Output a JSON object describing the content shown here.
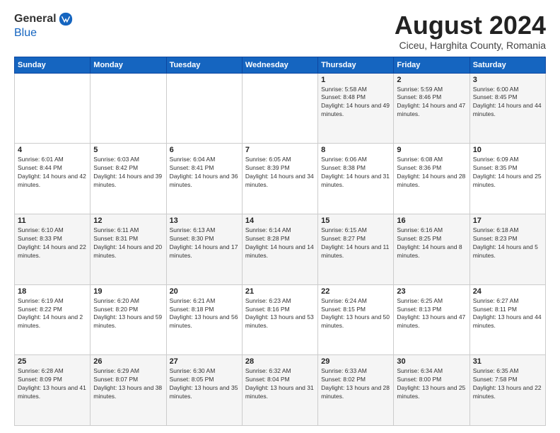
{
  "logo": {
    "general": "General",
    "blue": "Blue"
  },
  "title": {
    "month_year": "August 2024",
    "location": "Ciceu, Harghita County, Romania"
  },
  "weekdays": [
    "Sunday",
    "Monday",
    "Tuesday",
    "Wednesday",
    "Thursday",
    "Friday",
    "Saturday"
  ],
  "weeks": [
    [
      {
        "day": "",
        "info": ""
      },
      {
        "day": "",
        "info": ""
      },
      {
        "day": "",
        "info": ""
      },
      {
        "day": "",
        "info": ""
      },
      {
        "day": "1",
        "info": "Sunrise: 5:58 AM\nSunset: 8:48 PM\nDaylight: 14 hours and 49 minutes."
      },
      {
        "day": "2",
        "info": "Sunrise: 5:59 AM\nSunset: 8:46 PM\nDaylight: 14 hours and 47 minutes."
      },
      {
        "day": "3",
        "info": "Sunrise: 6:00 AM\nSunset: 8:45 PM\nDaylight: 14 hours and 44 minutes."
      }
    ],
    [
      {
        "day": "4",
        "info": "Sunrise: 6:01 AM\nSunset: 8:44 PM\nDaylight: 14 hours and 42 minutes."
      },
      {
        "day": "5",
        "info": "Sunrise: 6:03 AM\nSunset: 8:42 PM\nDaylight: 14 hours and 39 minutes."
      },
      {
        "day": "6",
        "info": "Sunrise: 6:04 AM\nSunset: 8:41 PM\nDaylight: 14 hours and 36 minutes."
      },
      {
        "day": "7",
        "info": "Sunrise: 6:05 AM\nSunset: 8:39 PM\nDaylight: 14 hours and 34 minutes."
      },
      {
        "day": "8",
        "info": "Sunrise: 6:06 AM\nSunset: 8:38 PM\nDaylight: 14 hours and 31 minutes."
      },
      {
        "day": "9",
        "info": "Sunrise: 6:08 AM\nSunset: 8:36 PM\nDaylight: 14 hours and 28 minutes."
      },
      {
        "day": "10",
        "info": "Sunrise: 6:09 AM\nSunset: 8:35 PM\nDaylight: 14 hours and 25 minutes."
      }
    ],
    [
      {
        "day": "11",
        "info": "Sunrise: 6:10 AM\nSunset: 8:33 PM\nDaylight: 14 hours and 22 minutes."
      },
      {
        "day": "12",
        "info": "Sunrise: 6:11 AM\nSunset: 8:31 PM\nDaylight: 14 hours and 20 minutes."
      },
      {
        "day": "13",
        "info": "Sunrise: 6:13 AM\nSunset: 8:30 PM\nDaylight: 14 hours and 17 minutes."
      },
      {
        "day": "14",
        "info": "Sunrise: 6:14 AM\nSunset: 8:28 PM\nDaylight: 14 hours and 14 minutes."
      },
      {
        "day": "15",
        "info": "Sunrise: 6:15 AM\nSunset: 8:27 PM\nDaylight: 14 hours and 11 minutes."
      },
      {
        "day": "16",
        "info": "Sunrise: 6:16 AM\nSunset: 8:25 PM\nDaylight: 14 hours and 8 minutes."
      },
      {
        "day": "17",
        "info": "Sunrise: 6:18 AM\nSunset: 8:23 PM\nDaylight: 14 hours and 5 minutes."
      }
    ],
    [
      {
        "day": "18",
        "info": "Sunrise: 6:19 AM\nSunset: 8:22 PM\nDaylight: 14 hours and 2 minutes."
      },
      {
        "day": "19",
        "info": "Sunrise: 6:20 AM\nSunset: 8:20 PM\nDaylight: 13 hours and 59 minutes."
      },
      {
        "day": "20",
        "info": "Sunrise: 6:21 AM\nSunset: 8:18 PM\nDaylight: 13 hours and 56 minutes."
      },
      {
        "day": "21",
        "info": "Sunrise: 6:23 AM\nSunset: 8:16 PM\nDaylight: 13 hours and 53 minutes."
      },
      {
        "day": "22",
        "info": "Sunrise: 6:24 AM\nSunset: 8:15 PM\nDaylight: 13 hours and 50 minutes."
      },
      {
        "day": "23",
        "info": "Sunrise: 6:25 AM\nSunset: 8:13 PM\nDaylight: 13 hours and 47 minutes."
      },
      {
        "day": "24",
        "info": "Sunrise: 6:27 AM\nSunset: 8:11 PM\nDaylight: 13 hours and 44 minutes."
      }
    ],
    [
      {
        "day": "25",
        "info": "Sunrise: 6:28 AM\nSunset: 8:09 PM\nDaylight: 13 hours and 41 minutes."
      },
      {
        "day": "26",
        "info": "Sunrise: 6:29 AM\nSunset: 8:07 PM\nDaylight: 13 hours and 38 minutes."
      },
      {
        "day": "27",
        "info": "Sunrise: 6:30 AM\nSunset: 8:05 PM\nDaylight: 13 hours and 35 minutes."
      },
      {
        "day": "28",
        "info": "Sunrise: 6:32 AM\nSunset: 8:04 PM\nDaylight: 13 hours and 31 minutes."
      },
      {
        "day": "29",
        "info": "Sunrise: 6:33 AM\nSunset: 8:02 PM\nDaylight: 13 hours and 28 minutes."
      },
      {
        "day": "30",
        "info": "Sunrise: 6:34 AM\nSunset: 8:00 PM\nDaylight: 13 hours and 25 minutes."
      },
      {
        "day": "31",
        "info": "Sunrise: 6:35 AM\nSunset: 7:58 PM\nDaylight: 13 hours and 22 minutes."
      }
    ]
  ]
}
